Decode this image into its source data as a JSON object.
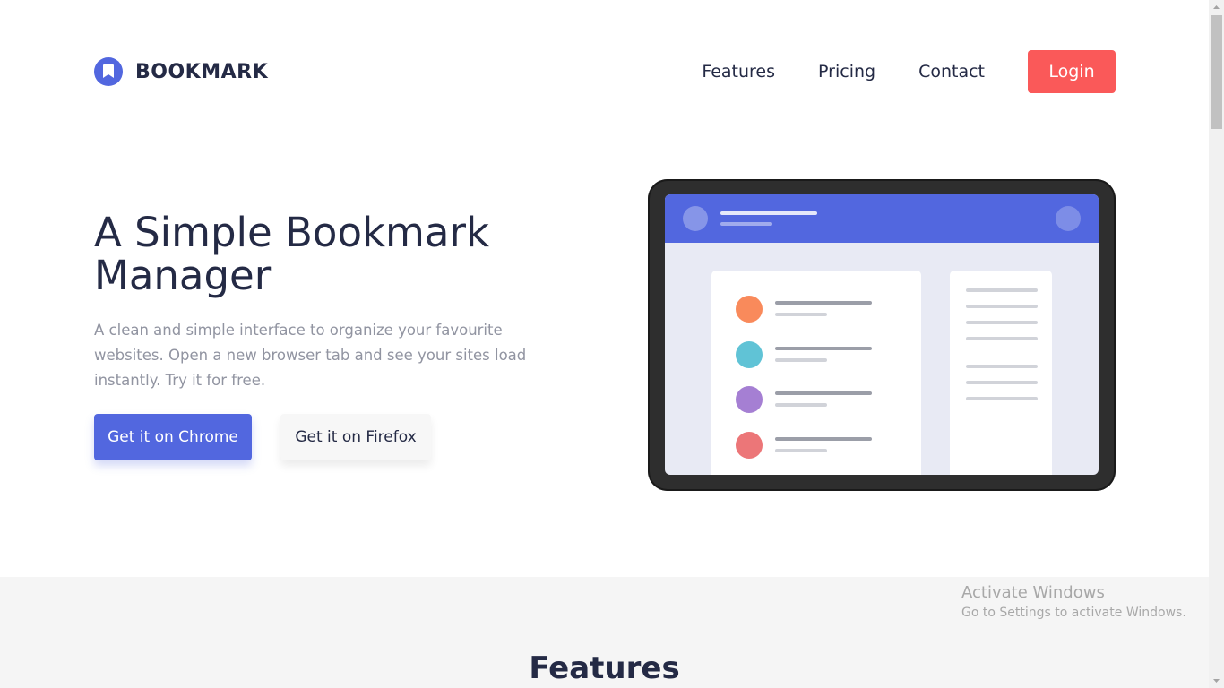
{
  "header": {
    "logo_text": "BOOKMARK",
    "nav": [
      "Features",
      "Pricing",
      "Contact"
    ],
    "login_label": "Login"
  },
  "hero": {
    "title_line1": "A Simple Bookmark",
    "title_line2": "Manager",
    "description": "A clean and simple interface to organize your favourite websites. Open a new browser tab and see your sites load instantly. Try it for free.",
    "chrome_button": "Get it on Chrome",
    "firefox_button": "Get it on Firefox"
  },
  "illustration": {
    "list_dot_colors": [
      "#F98A5B",
      "#60C3D6",
      "#A57FD3",
      "#EC7678"
    ],
    "accent": "#5267DF"
  },
  "features": {
    "title": "Features"
  },
  "watermark": {
    "title": "Activate Windows",
    "subtitle": "Go to Settings to activate Windows."
  },
  "colors": {
    "primary": "#5267DF",
    "login": "#FA5959",
    "text": "#242A45",
    "muted": "#9194A1"
  }
}
